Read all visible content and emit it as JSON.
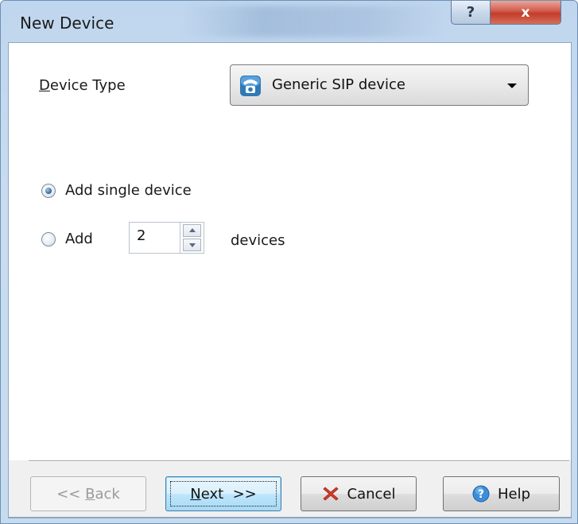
{
  "window": {
    "title": "New Device",
    "help_glyph": "?",
    "close_glyph": "x"
  },
  "device_type": {
    "label": "Device Type",
    "label_accel": "D",
    "label_rest": "evice Type",
    "selected": "Generic SIP device",
    "icon": "telephone-icon"
  },
  "options": {
    "single": {
      "label": "Add single device",
      "checked": true
    },
    "multiple": {
      "prefix": "Add",
      "count": "2",
      "suffix": "devices",
      "checked": false
    }
  },
  "buttons": {
    "back": {
      "prefix": "<< ",
      "accel": "B",
      "rest": "ack",
      "enabled": false
    },
    "next": {
      "accel": "N",
      "rest": "ext",
      "suffix": "  >>"
    },
    "cancel": {
      "label": "Cancel",
      "icon": "red-x-icon"
    },
    "help": {
      "label": "Help",
      "icon": "question-icon"
    }
  }
}
